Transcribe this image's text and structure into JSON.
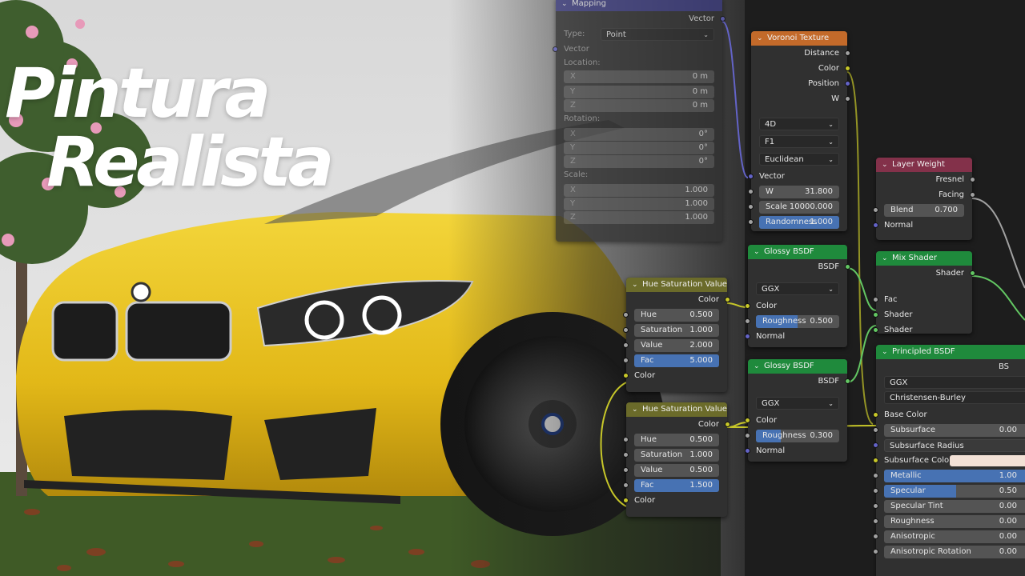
{
  "title": {
    "line1": "Pintura",
    "line2": "Realista"
  },
  "colors": {
    "background": "#1d1d1d",
    "car": "#e8c21e",
    "vector_header": "#3c3c83",
    "texture_header": "#c36a2a",
    "shader_header": "#1f8a3c",
    "input_header": "#83314a",
    "color_header": "#6b6b2a",
    "field_fill": "#4772b3"
  },
  "mapping": {
    "title": "Mapping",
    "output": "Vector",
    "type_label": "Type:",
    "type_value": "Point",
    "vector_label": "Vector",
    "location_label": "Location:",
    "location": [
      {
        "axis": "X",
        "value": "0 m"
      },
      {
        "axis": "Y",
        "value": "0 m"
      },
      {
        "axis": "Z",
        "value": "0 m"
      }
    ],
    "rotation_label": "Rotation:",
    "rotation": [
      {
        "axis": "X",
        "value": "0°"
      },
      {
        "axis": "Y",
        "value": "0°"
      },
      {
        "axis": "Z",
        "value": "0°"
      }
    ],
    "scale_label": "Scale:",
    "scale": [
      {
        "axis": "X",
        "value": "1.000"
      },
      {
        "axis": "Y",
        "value": "1.000"
      },
      {
        "axis": "Z",
        "value": "1.000"
      }
    ]
  },
  "voronoi": {
    "title": "Voronoi Texture",
    "outputs": [
      "Distance",
      "Color",
      "Position",
      "W"
    ],
    "dimensions": "4D",
    "feature": "F1",
    "metric": "Euclidean",
    "vector_label": "Vector",
    "w_label": "W",
    "w_value": "31.800",
    "scale_label": "Scale",
    "scale_value": "10000.000",
    "randomness_label": "Randomness",
    "randomness_value": "1.000",
    "randomness_fraction": 1.0
  },
  "layer_weight": {
    "title": "Layer Weight",
    "outputs": [
      "Fresnel",
      "Facing"
    ],
    "blend_label": "Blend",
    "blend_value": "0.700",
    "normal_label": "Normal"
  },
  "mix_shader": {
    "title": "Mix Shader",
    "output": "Shader",
    "inputs": [
      "Fac",
      "Shader",
      "Shader"
    ]
  },
  "glossy1": {
    "title": "Glossy BSDF",
    "output": "BSDF",
    "distribution": "GGX",
    "color_label": "Color",
    "roughness_label": "Roughness",
    "roughness_value": "0.500",
    "roughness_fraction": 0.5,
    "normal_label": "Normal"
  },
  "glossy2": {
    "title": "Glossy BSDF",
    "output": "BSDF",
    "distribution": "GGX",
    "color_label": "Color",
    "roughness_label": "Roughness",
    "roughness_value": "0.300",
    "roughness_fraction": 0.3,
    "normal_label": "Normal"
  },
  "hsv1": {
    "title": "Hue Saturation Value",
    "output": "Color",
    "fields": [
      {
        "label": "Hue",
        "value": "0.500"
      },
      {
        "label": "Saturation",
        "value": "1.000"
      },
      {
        "label": "Value",
        "value": "2.000"
      },
      {
        "label": "Fac",
        "value": "5.000"
      }
    ],
    "color_label": "Color"
  },
  "hsv2": {
    "title": "Hue Saturation Value",
    "output": "Color",
    "fields": [
      {
        "label": "Hue",
        "value": "0.500"
      },
      {
        "label": "Saturation",
        "value": "1.000"
      },
      {
        "label": "Value",
        "value": "0.500"
      },
      {
        "label": "Fac",
        "value": "1.500"
      }
    ],
    "color_label": "Color"
  },
  "principled": {
    "title": "Principled BSDF",
    "output": "BS",
    "distribution": "GGX",
    "subsurface_method": "Christensen-Burley",
    "base_color_label": "Base Color",
    "fields": [
      {
        "label": "Subsurface",
        "value": "0.00",
        "fraction": 0
      },
      {
        "label": "Subsurface Radius",
        "value": "",
        "fraction": 0
      },
      {
        "label": "Subsurface Colo",
        "value": "",
        "fraction": 0
      },
      {
        "label": "Metallic",
        "value": "1.00",
        "fraction": 1.0
      },
      {
        "label": "Specular",
        "value": "0.50",
        "fraction": 0.5
      },
      {
        "label": "Specular Tint",
        "value": "0.00",
        "fraction": 0
      },
      {
        "label": "Roughness",
        "value": "0.00",
        "fraction": 0
      },
      {
        "label": "Anisotropic",
        "value": "0.00",
        "fraction": 0
      },
      {
        "label": "Anisotropic Rotation",
        "value": "0.00",
        "fraction": 0
      }
    ]
  }
}
